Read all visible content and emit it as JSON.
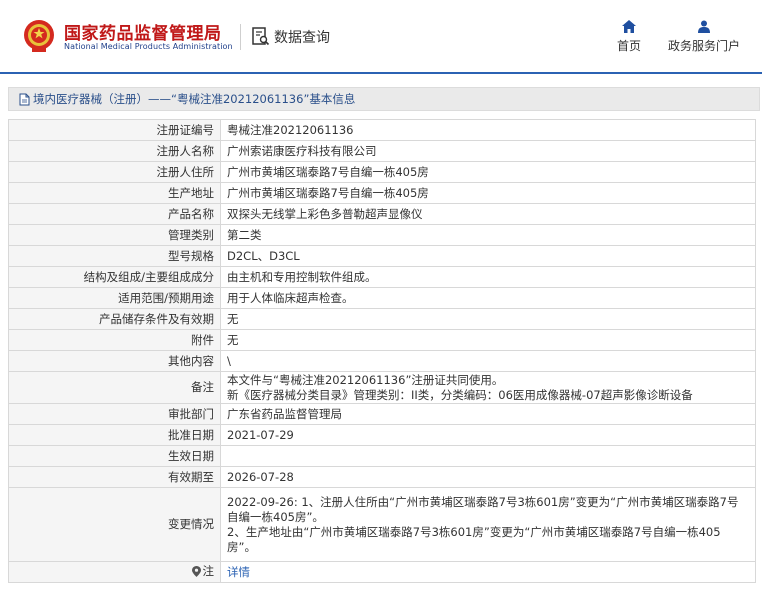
{
  "header": {
    "brand_cn": "国家药品监督管理局",
    "brand_en": "National Medical Products Administration",
    "query_label": "数据查询",
    "nav_home": "首页",
    "nav_portal": "政务服务门户"
  },
  "title_bar": {
    "text": "境内医疗器械（注册）——“粤械注准20212061136”基本信息"
  },
  "rows": [
    {
      "label": "注册证编号",
      "value": "粤械注准20212061136"
    },
    {
      "label": "注册人名称",
      "value": "广州索诺康医疗科技有限公司"
    },
    {
      "label": "注册人住所",
      "value": "广州市黄埔区瑞泰路7号自编一栋405房"
    },
    {
      "label": "生产地址",
      "value": "广州市黄埔区瑞泰路7号自编一栋405房"
    },
    {
      "label": "产品名称",
      "value": "双探头无线掌上彩色多普勒超声显像仪"
    },
    {
      "label": "管理类别",
      "value": "第二类"
    },
    {
      "label": "型号规格",
      "value": "D2CL、D3CL"
    },
    {
      "label": "结构及组成/主要组成成分",
      "value": "由主机和专用控制软件组成。"
    },
    {
      "label": "适用范围/预期用途",
      "value": "用于人体临床超声检查。"
    },
    {
      "label": "产品储存条件及有效期",
      "value": "无"
    },
    {
      "label": "附件",
      "value": "无"
    },
    {
      "label": "其他内容",
      "value": "\\"
    },
    {
      "label": "备注",
      "line1": "本文件与“粤械注准20212061136”注册证共同使用。",
      "line2": "新《医疗器械分类目录》管理类别：II类，分类编码：06医用成像器械-07超声影像诊断设备"
    },
    {
      "label": "审批部门",
      "value": "广东省药品监督管理局"
    },
    {
      "label": "批准日期",
      "value": "2021-07-29"
    },
    {
      "label": "生效日期",
      "value": ""
    },
    {
      "label": "有效期至",
      "value": "2026-07-28"
    },
    {
      "label": "变更情况",
      "line1": "2022-09-26: 1、注册人住所由“广州市黄埔区瑞泰路7号3栋601房”变更为“广州市黄埔区瑞泰路7号自编一栋405房”。",
      "line2": "2、生产地址由“广州市黄埔区瑞泰路7号3栋601房”变更为“广州市黄埔区瑞泰路7号自编一栋405房”。"
    },
    {
      "label": "注",
      "value": "详情"
    }
  ],
  "colors": {
    "brand_red": "#c01818",
    "brand_blue": "#2b62b3",
    "link_blue": "#2b62b3"
  },
  "icons": {
    "emblem": "national-emblem-icon",
    "query": "document-search-icon",
    "home": "home-icon",
    "portal": "user-icon",
    "title": "document-icon",
    "location": "location-pin-icon"
  }
}
